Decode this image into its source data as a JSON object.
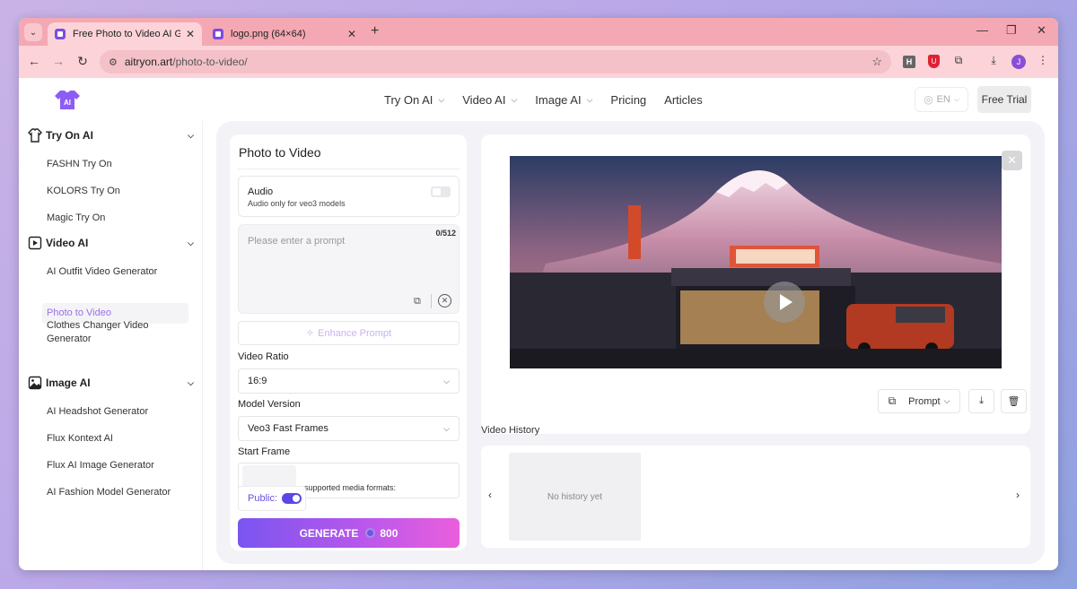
{
  "browser": {
    "tabs": [
      {
        "title": "Free Photo to Video AI Generat",
        "close": "✕"
      },
      {
        "title": "logo.png (64×64)",
        "close": "✕"
      }
    ],
    "new_tab": "+",
    "url_host": "aitryon.art",
    "url_path": "/photo-to-video/",
    "profile_initial": "J",
    "ext_h": "H"
  },
  "header": {
    "logo_text": "AI",
    "nav": [
      {
        "label": "Try On AI"
      },
      {
        "label": "Video AI"
      },
      {
        "label": "Image AI"
      },
      {
        "label": "Pricing"
      },
      {
        "label": "Articles"
      }
    ],
    "lang": "EN",
    "free_trial": "Free Trial"
  },
  "sidebar": {
    "sections": [
      {
        "title": "Try On AI",
        "items": [
          "FASHN Try On",
          "KOLORS Try On",
          "Magic Try On"
        ]
      },
      {
        "title": "Video AI",
        "items": [
          "AI Outfit Video Generator",
          "Photo to Video",
          "Clothes Changer Video Generator"
        ]
      },
      {
        "title": "Image AI",
        "items": [
          "AI Headshot Generator",
          "Flux Kontext AI",
          "Flux AI Image Generator",
          "AI Fashion Model Generator"
        ]
      }
    ],
    "active_item": "Photo to Video"
  },
  "form": {
    "title": "Photo to Video",
    "audio_label": "Audio",
    "audio_sub": "Audio only for veo3 models",
    "prompt_placeholder": "Please enter a prompt",
    "prompt_count": "0/512",
    "enhance_label": "Enhance Prompt",
    "ratio_label": "Video Ratio",
    "ratio_value": "16:9",
    "model_label": "Model Version",
    "model_value": "Veo3 Fast Frames",
    "start_frame_label": "Start Frame",
    "start_frame_formats": "supported media formats:",
    "public_label": "Public:",
    "generate_label": "GENERATE",
    "generate_cost": "800"
  },
  "preview": {
    "sign_text": "LAWSON STATION",
    "prompt_button": "Prompt"
  },
  "history": {
    "title": "Video History",
    "empty": "No history yet"
  },
  "colors": {
    "accent": "#7a55f0",
    "active_link": "#9a6fe8",
    "tab_bar": "#f4a8b3"
  }
}
